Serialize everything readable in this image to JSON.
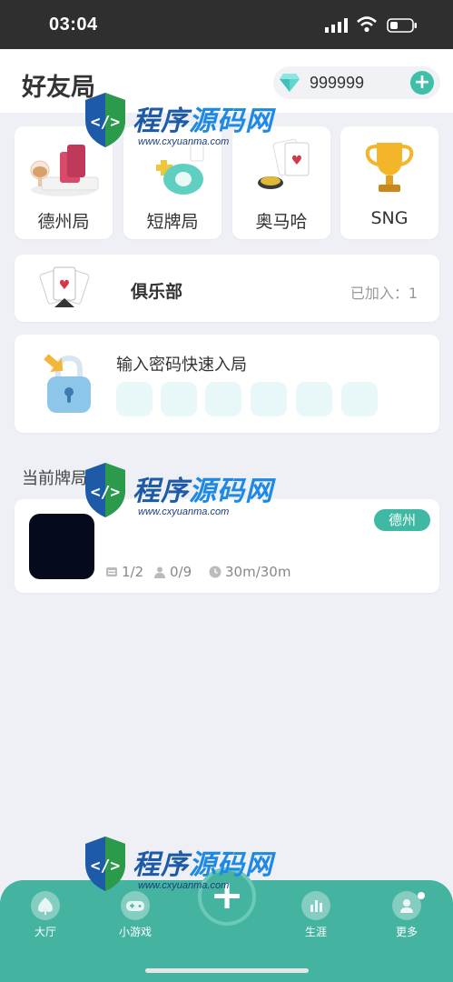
{
  "status_bar": {
    "time": "03:04"
  },
  "header": {
    "title": "好友局",
    "balance": "999999",
    "add_label": "+"
  },
  "game_types": [
    {
      "label": "德州局",
      "icon": "poker-chips-icon"
    },
    {
      "label": "短牌局",
      "icon": "short-deck-icon"
    },
    {
      "label": "奥马哈",
      "icon": "omaha-cards-icon"
    },
    {
      "label": "SNG",
      "icon": "trophy-icon"
    }
  ],
  "club": {
    "title": "俱乐部",
    "joined": "已加入：1"
  },
  "password": {
    "title": "输入密码快速入局",
    "box_count": 6
  },
  "current_tables": {
    "section_title": "当前牌局",
    "items": [
      {
        "tag": "德州",
        "seats": "1/2",
        "players": "0/9",
        "time": "30m/30m"
      }
    ]
  },
  "bottom_nav": [
    {
      "label": "大厅",
      "icon": "spade-icon"
    },
    {
      "label": "小游戏",
      "icon": "gamepad-icon"
    },
    {
      "label": "生涯",
      "icon": "stats-icon"
    },
    {
      "label": "更多",
      "icon": "profile-icon"
    }
  ],
  "watermark": {
    "text": "程序源码网",
    "url": "www.cxyuanma.com"
  },
  "colors": {
    "accent": "#44b3a0",
    "tag": "#3fb8a4",
    "pwd_box": "#e8f7f7"
  }
}
